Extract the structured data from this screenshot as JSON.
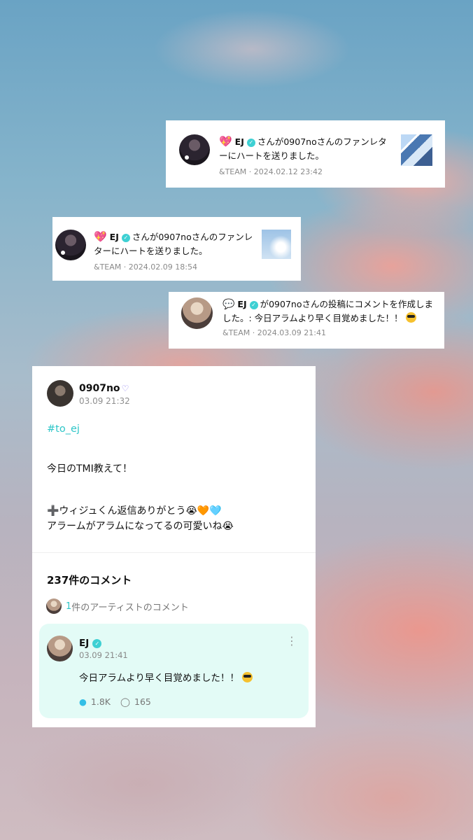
{
  "notifications": [
    {
      "icon": "heart-icon",
      "name": "EJ",
      "text": "さんが0907noさんのファンレターにハートを送りました。",
      "group": "&TEAM",
      "date": "2024.02.12 23:42"
    },
    {
      "icon": "heart-icon",
      "name": "EJ",
      "text": "さんが0907noさんのファンレターにハートを送りました。",
      "group": "&TEAM",
      "date": "2024.02.09 18:54"
    },
    {
      "icon": "speech-bubble-icon",
      "name": "EJ",
      "text": "が0907noさんの投稿にコメントを作成しました。: 今日アラムより早く目覚めました！！",
      "group": "&TEAM",
      "date": "2024.03.09 21:41"
    }
  ],
  "post": {
    "username": "0907no",
    "date": "03.09 21:32",
    "hashtag": "#to_ej",
    "line1": "今日のTMI教えて！",
    "line2": "➕ウィジュくん返信ありがとう😭🧡🩵",
    "line3": "アラームがアラムになってるの可愛いね😭",
    "comments_title": "237件のコメント",
    "artist_count": "1",
    "artist_label": "件のアーティストのコメント",
    "reply": {
      "name": "EJ",
      "date": "03.09 21:41",
      "text": "今日アラムより早く目覚めました！！",
      "likes": "1.8K",
      "comments": "165"
    }
  },
  "colors": {
    "accent": "#2ec6c8",
    "verified": "#3ed0d3",
    "reply_bg": "#e3fbf6"
  }
}
